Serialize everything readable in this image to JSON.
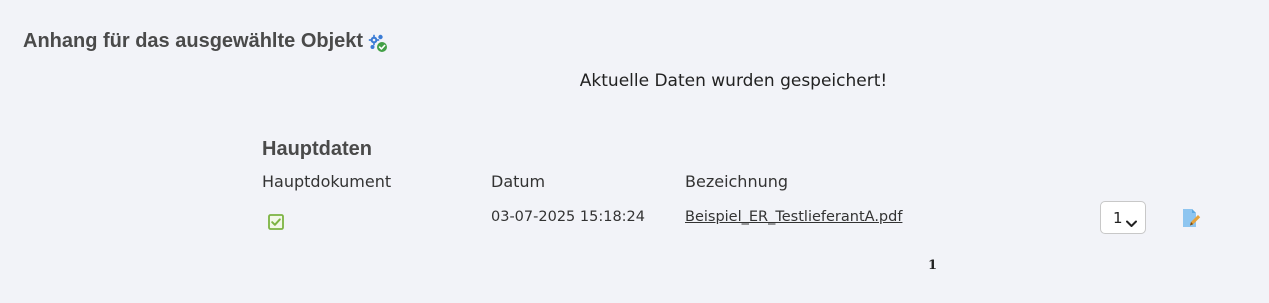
{
  "header": {
    "title": "Anhang für das ausgewählte Objekt",
    "icon": "settings-check-icon"
  },
  "status_message": "Aktuelle Daten wurden gespeichert!",
  "section": {
    "title": "Hauptdaten"
  },
  "table": {
    "columns": [
      "Hauptdokument",
      "Datum",
      "Bezeichnung"
    ],
    "rows": [
      {
        "main_document": true,
        "date": "03-07-2025 15:18:24",
        "description": "Beispiel_ER_TestlieferantA.pdf",
        "select_value": "1",
        "edit_icon": "edit-document-icon"
      }
    ]
  },
  "pagination": {
    "current_page": "1"
  },
  "colors": {
    "background": "#f2f3f8",
    "checkbox_green": "#7cb342",
    "gear_blue": "#3a7bd5",
    "doc_blue": "#8ec5f0",
    "pencil_orange": "#e5a23c"
  }
}
